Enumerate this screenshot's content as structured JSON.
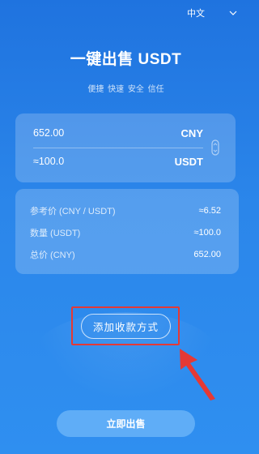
{
  "header": {
    "language": "中文"
  },
  "title": "一键出售 USDT",
  "subtitle": "便捷 快速 安全 信任",
  "input_card": {
    "amount_value": "652.00",
    "amount_currency": "CNY",
    "quantity_value": "≈100.0",
    "quantity_currency": "USDT"
  },
  "info_card": {
    "rows": [
      {
        "label": "参考价 (CNY / USDT)",
        "value": "≈6.52"
      },
      {
        "label": "数量 (USDT)",
        "value": "≈100.0"
      },
      {
        "label": "总价 (CNY)",
        "value": "652.00"
      }
    ]
  },
  "buttons": {
    "add_payment": "添加收款方式",
    "sell_now": "立即出售"
  },
  "colors": {
    "background_top": "#1f73df",
    "background_bottom": "#2f8ff0",
    "highlight": "#e53935",
    "sell_button": "#5fadf7"
  }
}
